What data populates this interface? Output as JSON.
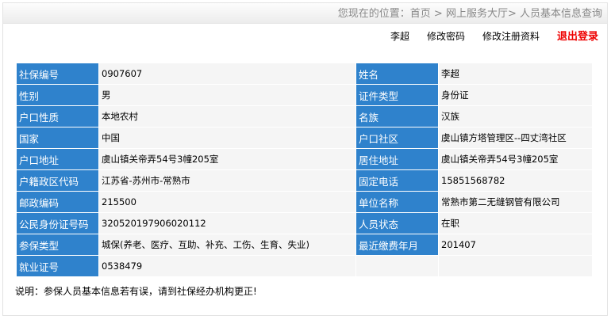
{
  "breadcrumb": {
    "prefix": "您现在的位置：",
    "items": [
      "首页",
      "网上服务大厅",
      "人员基本信息查询"
    ]
  },
  "user_links": {
    "username": "李超",
    "change_password": "修改密码",
    "edit_registration": "修改注册资料",
    "logout": "退出登录"
  },
  "rows": [
    {
      "l1": "社保编号",
      "v1": "0907607",
      "l2": "姓名",
      "v2": "李超"
    },
    {
      "l1": "性别",
      "v1": "男",
      "l2": "证件类型",
      "v2": "身份证"
    },
    {
      "l1": "户口性质",
      "v1": "本地农村",
      "l2": "名族",
      "v2": "汉族"
    },
    {
      "l1": "国家",
      "v1": "中国",
      "l2": "户口社区",
      "v2": "虞山镇方塔管理区--四丈湾社区"
    },
    {
      "l1": "户口地址",
      "v1": "虞山镇关帝弄54号3幢205室",
      "l2": "居住地址",
      "v2": "虞山镇关帝弄54号3幢205室"
    },
    {
      "l1": "户籍政区代码",
      "v1": "江苏省-苏州市-常熟市",
      "l2": "固定电话",
      "v2": "15851568782"
    },
    {
      "l1": "邮政编码",
      "v1": "215500",
      "l2": "单位名称",
      "v2": "常熟市第二无缝钢管有限公司"
    },
    {
      "l1": "公民身份证号码",
      "v1": "320520197906020112",
      "l2": "人员状态",
      "v2": "在职"
    },
    {
      "l1": "参保类型",
      "v1": "城保(养老、医疗、互助、补充、工伤、生育、失业)",
      "l2": "最近缴费年月",
      "v2": "201407"
    },
    {
      "l1": "就业证号",
      "v1": "0538479",
      "l2": "",
      "v2": ""
    }
  ],
  "note": "说明：参保人员基本信息若有误，请到社保经办机构更正!"
}
